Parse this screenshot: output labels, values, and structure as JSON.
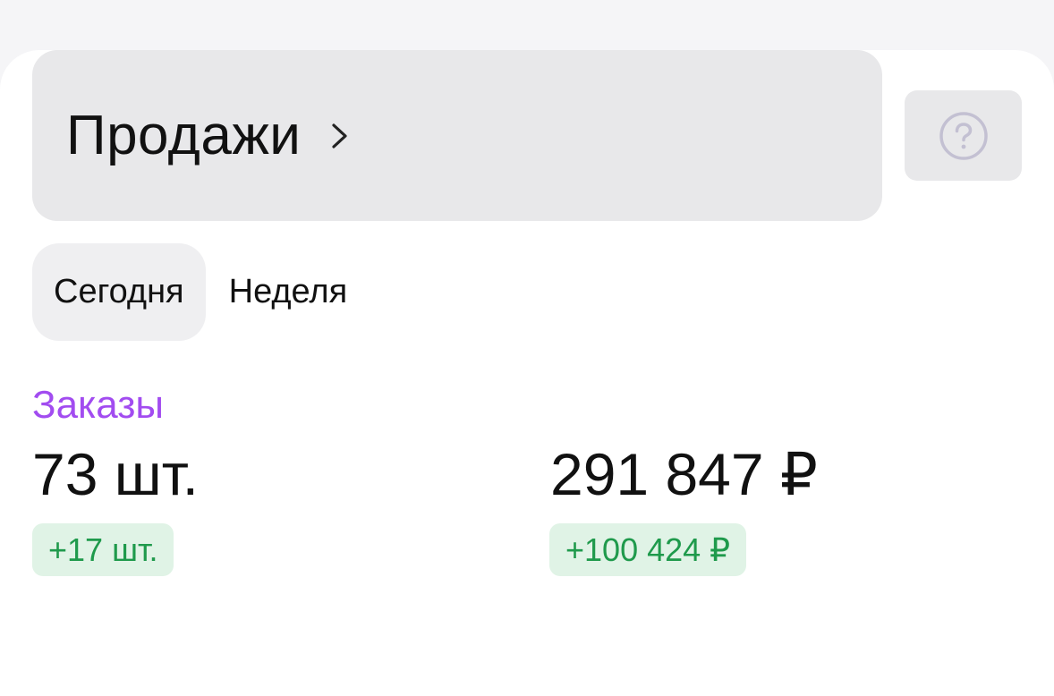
{
  "header": {
    "title": "Продажи",
    "chevron_icon": "chevron-right-icon",
    "help_icon": "question-circle-icon"
  },
  "tabs": [
    {
      "label": "Сегодня",
      "active": true
    },
    {
      "label": "Неделя",
      "active": false
    }
  ],
  "metric": {
    "label": "Заказы",
    "count_value": "73 шт.",
    "count_delta": "+17 шт.",
    "sum_value": "291 847 ₽",
    "sum_delta": "+100 424 ₽"
  },
  "colors": {
    "accent_label": "#a24cf0",
    "delta_text": "#1f9a4c",
    "delta_bg": "#e0f3e6",
    "button_bg": "#e8e8ea"
  }
}
